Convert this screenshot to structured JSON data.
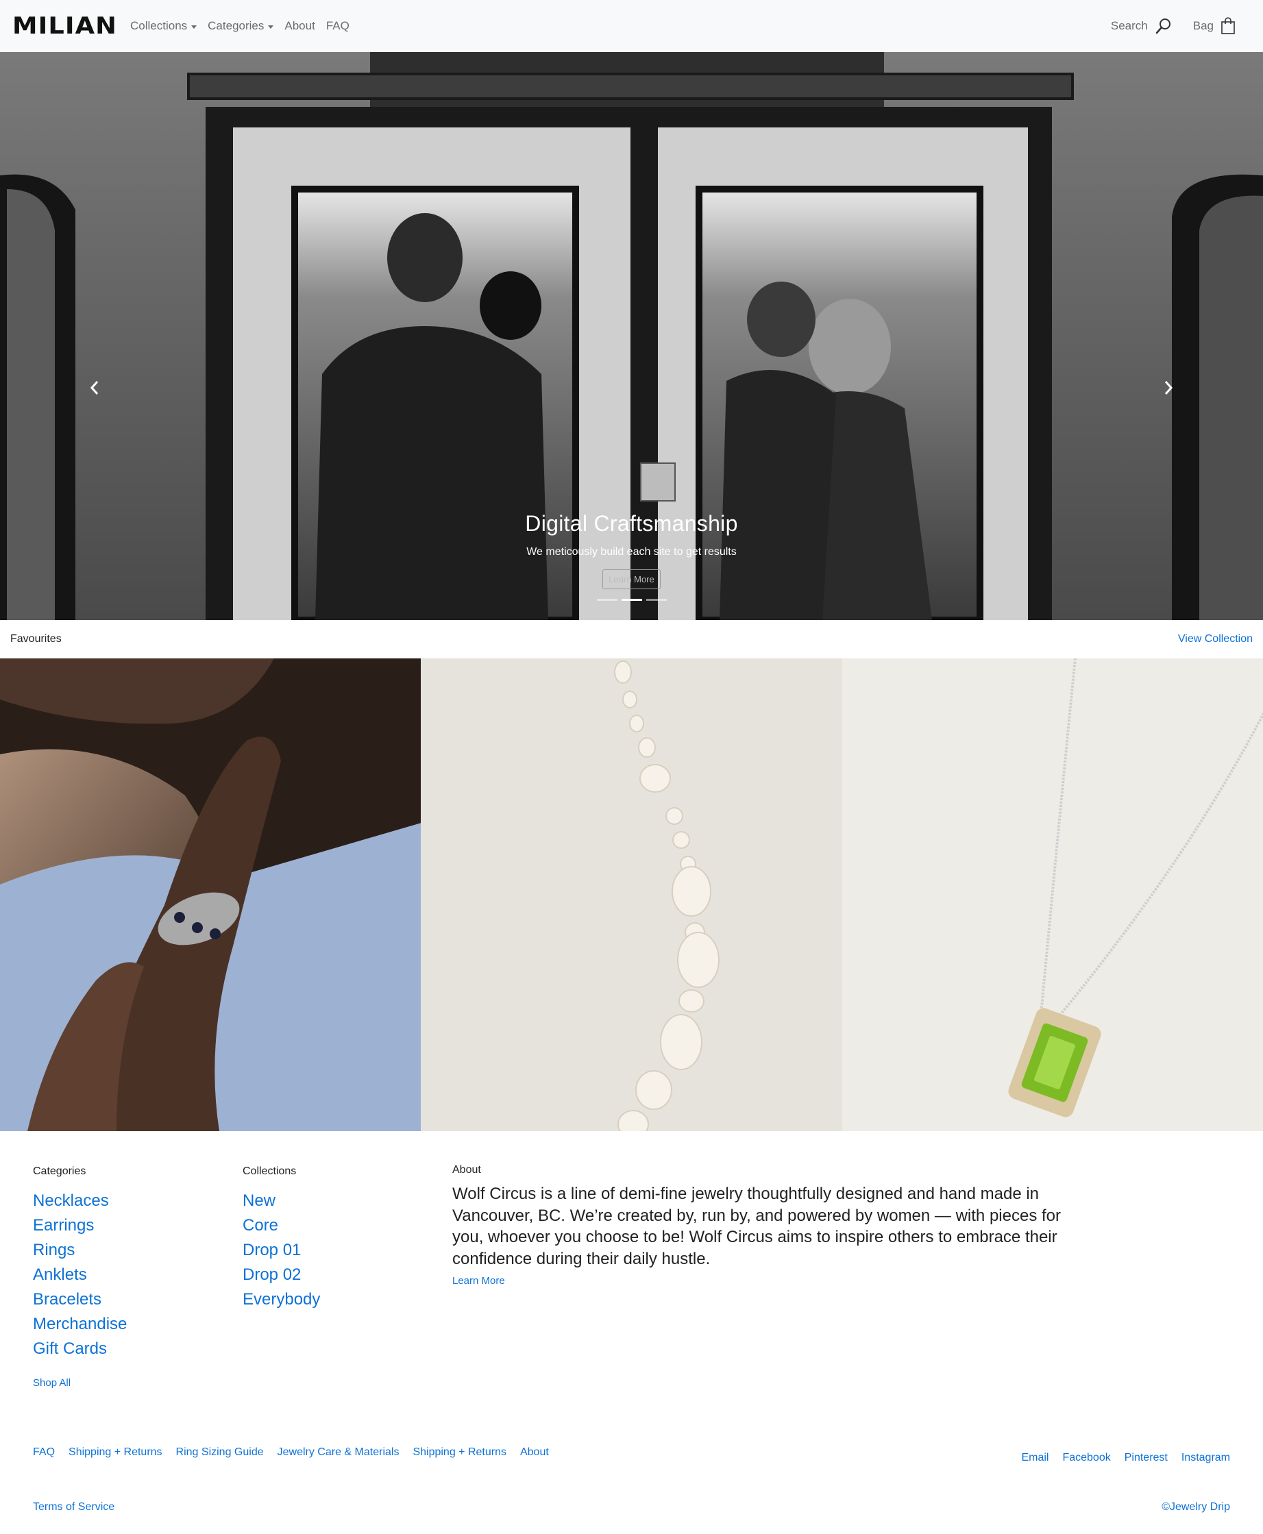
{
  "navbar": {
    "logo": "MILIAN",
    "links": [
      {
        "label": "Collections",
        "dropdown": true
      },
      {
        "label": "Categories",
        "dropdown": true
      },
      {
        "label": "About",
        "dropdown": false
      },
      {
        "label": "FAQ",
        "dropdown": false
      }
    ],
    "search_label": "Search",
    "bag_label": "Bag",
    "icons": {
      "search": "search-icon",
      "bag": "shopping-bag-icon"
    }
  },
  "hero": {
    "title": "Digital Craftsmanship",
    "subtitle": "We meticously build each site to get results",
    "button_label": "Learn More",
    "slide_count": 3,
    "active_slide": 2,
    "icons": {
      "prev": "chevron-left-icon",
      "next": "chevron-right-icon"
    }
  },
  "favourites": {
    "title": "Favourites",
    "view_label": "View Collection",
    "images": [
      "silver ring with dark stones on hand",
      "baroque pearl necklace",
      "green gemstone pendant on chain"
    ]
  },
  "footer": {
    "categories": {
      "heading": "Categories",
      "items": [
        "Necklaces",
        "Earrings",
        "Rings",
        "Anklets",
        "Bracelets",
        "Merchandise",
        "Gift Cards"
      ],
      "shop_all": "Shop All"
    },
    "collections": {
      "heading": "Collections",
      "items": [
        "New",
        "Core",
        "Drop 01",
        "Drop 02",
        "Everybody"
      ]
    },
    "about": {
      "heading": "About",
      "text": "Wolf Circus is a line of demi-fine jewelry thoughtfully designed and hand made in Vancouver, BC. We’re created by, run by, and powered by women — with pieces for you, whoever you choose to be! Wolf Circus aims to inspire others to embrace their confidence during their daily hustle.",
      "learn_more": "Learn More"
    },
    "bottom_links": [
      "FAQ",
      "Shipping + Returns",
      "Ring Sizing Guide",
      "Jewelry Care & Materials",
      "Shipping + Returns",
      "About"
    ],
    "social_links": [
      "Email",
      "Facebook",
      "Pinterest",
      "Instagram"
    ],
    "terms": "Terms of Service",
    "copyright": "©Jewelry Drip"
  },
  "colors": {
    "link": "#0d72d6",
    "navbar_bg": "#f8f9fa",
    "text": "#222222"
  }
}
